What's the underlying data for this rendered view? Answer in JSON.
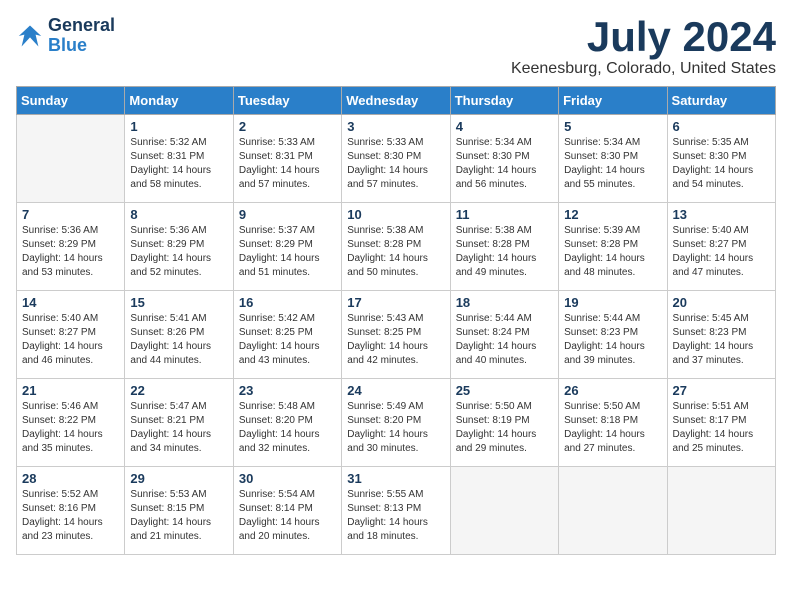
{
  "header": {
    "logo": {
      "line1": "General",
      "line2": "Blue"
    },
    "title": "July 2024",
    "location": "Keenesburg, Colorado, United States"
  },
  "weekdays": [
    "Sunday",
    "Monday",
    "Tuesday",
    "Wednesday",
    "Thursday",
    "Friday",
    "Saturday"
  ],
  "weeks": [
    [
      {
        "day": null,
        "info": null
      },
      {
        "day": "1",
        "info": "Sunrise: 5:32 AM\nSunset: 8:31 PM\nDaylight: 14 hours\nand 58 minutes."
      },
      {
        "day": "2",
        "info": "Sunrise: 5:33 AM\nSunset: 8:31 PM\nDaylight: 14 hours\nand 57 minutes."
      },
      {
        "day": "3",
        "info": "Sunrise: 5:33 AM\nSunset: 8:30 PM\nDaylight: 14 hours\nand 57 minutes."
      },
      {
        "day": "4",
        "info": "Sunrise: 5:34 AM\nSunset: 8:30 PM\nDaylight: 14 hours\nand 56 minutes."
      },
      {
        "day": "5",
        "info": "Sunrise: 5:34 AM\nSunset: 8:30 PM\nDaylight: 14 hours\nand 55 minutes."
      },
      {
        "day": "6",
        "info": "Sunrise: 5:35 AM\nSunset: 8:30 PM\nDaylight: 14 hours\nand 54 minutes."
      }
    ],
    [
      {
        "day": "7",
        "info": "Sunrise: 5:36 AM\nSunset: 8:29 PM\nDaylight: 14 hours\nand 53 minutes."
      },
      {
        "day": "8",
        "info": "Sunrise: 5:36 AM\nSunset: 8:29 PM\nDaylight: 14 hours\nand 52 minutes."
      },
      {
        "day": "9",
        "info": "Sunrise: 5:37 AM\nSunset: 8:29 PM\nDaylight: 14 hours\nand 51 minutes."
      },
      {
        "day": "10",
        "info": "Sunrise: 5:38 AM\nSunset: 8:28 PM\nDaylight: 14 hours\nand 50 minutes."
      },
      {
        "day": "11",
        "info": "Sunrise: 5:38 AM\nSunset: 8:28 PM\nDaylight: 14 hours\nand 49 minutes."
      },
      {
        "day": "12",
        "info": "Sunrise: 5:39 AM\nSunset: 8:28 PM\nDaylight: 14 hours\nand 48 minutes."
      },
      {
        "day": "13",
        "info": "Sunrise: 5:40 AM\nSunset: 8:27 PM\nDaylight: 14 hours\nand 47 minutes."
      }
    ],
    [
      {
        "day": "14",
        "info": "Sunrise: 5:40 AM\nSunset: 8:27 PM\nDaylight: 14 hours\nand 46 minutes."
      },
      {
        "day": "15",
        "info": "Sunrise: 5:41 AM\nSunset: 8:26 PM\nDaylight: 14 hours\nand 44 minutes."
      },
      {
        "day": "16",
        "info": "Sunrise: 5:42 AM\nSunset: 8:25 PM\nDaylight: 14 hours\nand 43 minutes."
      },
      {
        "day": "17",
        "info": "Sunrise: 5:43 AM\nSunset: 8:25 PM\nDaylight: 14 hours\nand 42 minutes."
      },
      {
        "day": "18",
        "info": "Sunrise: 5:44 AM\nSunset: 8:24 PM\nDaylight: 14 hours\nand 40 minutes."
      },
      {
        "day": "19",
        "info": "Sunrise: 5:44 AM\nSunset: 8:23 PM\nDaylight: 14 hours\nand 39 minutes."
      },
      {
        "day": "20",
        "info": "Sunrise: 5:45 AM\nSunset: 8:23 PM\nDaylight: 14 hours\nand 37 minutes."
      }
    ],
    [
      {
        "day": "21",
        "info": "Sunrise: 5:46 AM\nSunset: 8:22 PM\nDaylight: 14 hours\nand 35 minutes."
      },
      {
        "day": "22",
        "info": "Sunrise: 5:47 AM\nSunset: 8:21 PM\nDaylight: 14 hours\nand 34 minutes."
      },
      {
        "day": "23",
        "info": "Sunrise: 5:48 AM\nSunset: 8:20 PM\nDaylight: 14 hours\nand 32 minutes."
      },
      {
        "day": "24",
        "info": "Sunrise: 5:49 AM\nSunset: 8:20 PM\nDaylight: 14 hours\nand 30 minutes."
      },
      {
        "day": "25",
        "info": "Sunrise: 5:50 AM\nSunset: 8:19 PM\nDaylight: 14 hours\nand 29 minutes."
      },
      {
        "day": "26",
        "info": "Sunrise: 5:50 AM\nSunset: 8:18 PM\nDaylight: 14 hours\nand 27 minutes."
      },
      {
        "day": "27",
        "info": "Sunrise: 5:51 AM\nSunset: 8:17 PM\nDaylight: 14 hours\nand 25 minutes."
      }
    ],
    [
      {
        "day": "28",
        "info": "Sunrise: 5:52 AM\nSunset: 8:16 PM\nDaylight: 14 hours\nand 23 minutes."
      },
      {
        "day": "29",
        "info": "Sunrise: 5:53 AM\nSunset: 8:15 PM\nDaylight: 14 hours\nand 21 minutes."
      },
      {
        "day": "30",
        "info": "Sunrise: 5:54 AM\nSunset: 8:14 PM\nDaylight: 14 hours\nand 20 minutes."
      },
      {
        "day": "31",
        "info": "Sunrise: 5:55 AM\nSunset: 8:13 PM\nDaylight: 14 hours\nand 18 minutes."
      },
      {
        "day": null,
        "info": null
      },
      {
        "day": null,
        "info": null
      },
      {
        "day": null,
        "info": null
      }
    ]
  ]
}
